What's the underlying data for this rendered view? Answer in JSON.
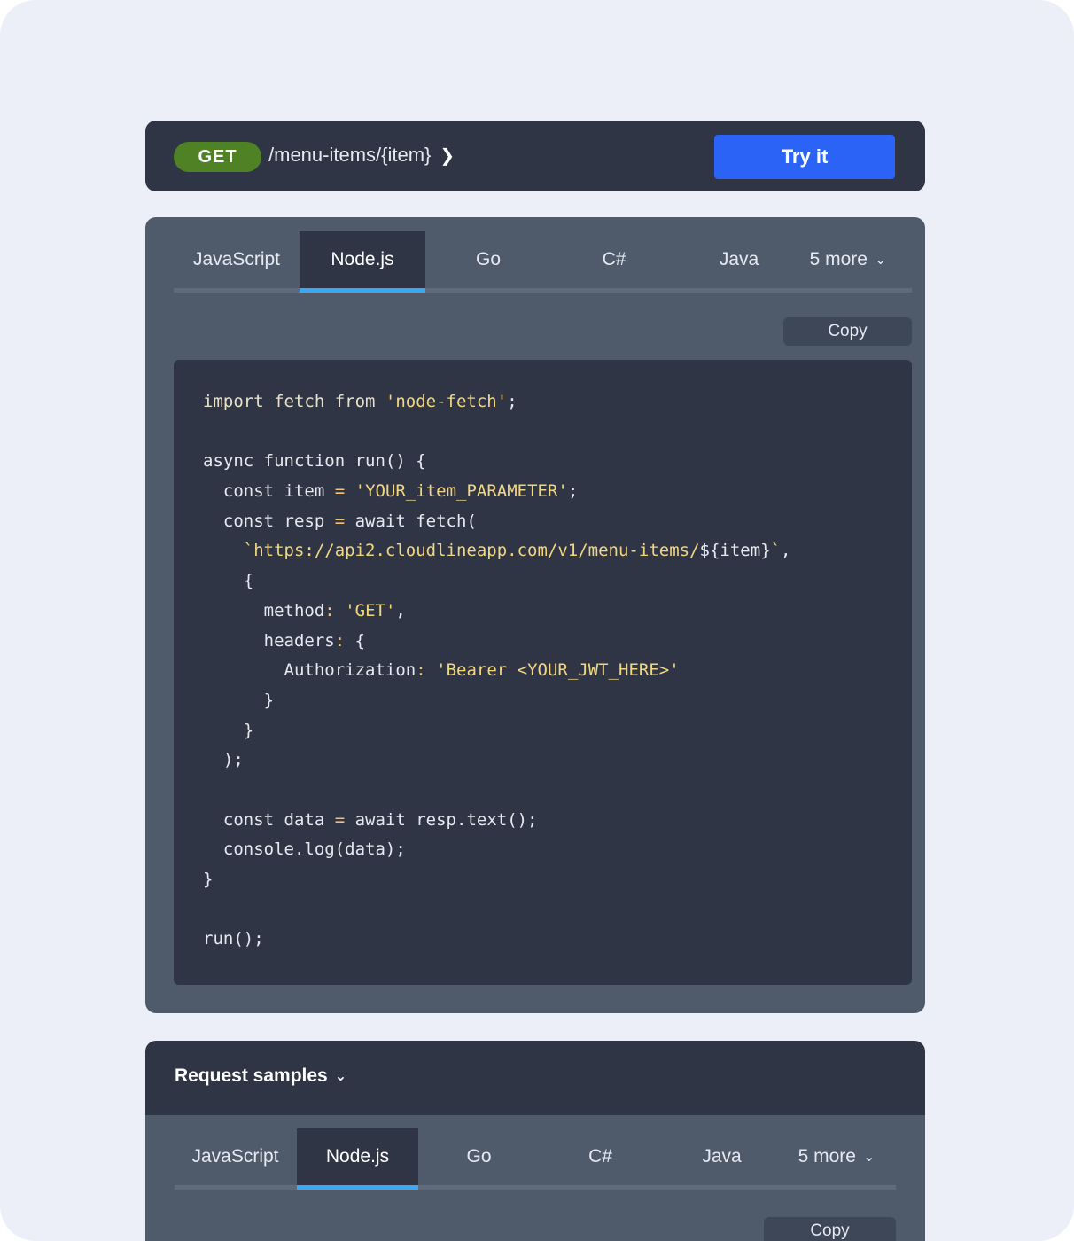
{
  "endpoint": {
    "method": "GET",
    "path": "/menu-items/{item}",
    "try_label": "Try it"
  },
  "tabs": [
    {
      "label": "JavaScript",
      "active": false
    },
    {
      "label": "Node.js",
      "active": true
    },
    {
      "label": "Go",
      "active": false
    },
    {
      "label": "C#",
      "active": false
    },
    {
      "label": "Java",
      "active": false
    },
    {
      "label": "5 more",
      "active": false
    }
  ],
  "copy_label": "Copy",
  "code": {
    "l1": {
      "a": "import fetch from ",
      "b": "'node-fetch'",
      "c": ";"
    },
    "l3": "async function run() {",
    "l4": {
      "a": "  const item ",
      "eq": "=",
      "b": " ",
      "s": "'YOUR_item_PARAMETER'",
      "c": ";"
    },
    "l5": {
      "a": "  const resp ",
      "eq": "=",
      "b": " await fetch("
    },
    "l6": {
      "s": "    `https://api2.cloudlineapp.com/v1/menu-items/",
      "a": "${item}",
      "s2": "`",
      "c": ","
    },
    "l7": "    {",
    "l8": {
      "a": "      method",
      "colon": ":",
      "b": " ",
      "s": "'GET'",
      "c": ","
    },
    "l9": {
      "a": "      headers",
      "colon": ":",
      "b": " {"
    },
    "l10": {
      "a": "        Authorization",
      "colon": ":",
      "b": " ",
      "s": "'Bearer <YOUR_JWT_HERE>'"
    },
    "l11": "      }",
    "l12": "    }",
    "l13": "  );",
    "l15": {
      "a": "  const data ",
      "eq": "=",
      "b": " await resp.text();"
    },
    "l16": "  console.log(data);",
    "l17": "}",
    "l19": "run();"
  },
  "samples": {
    "title": "Request samples"
  }
}
